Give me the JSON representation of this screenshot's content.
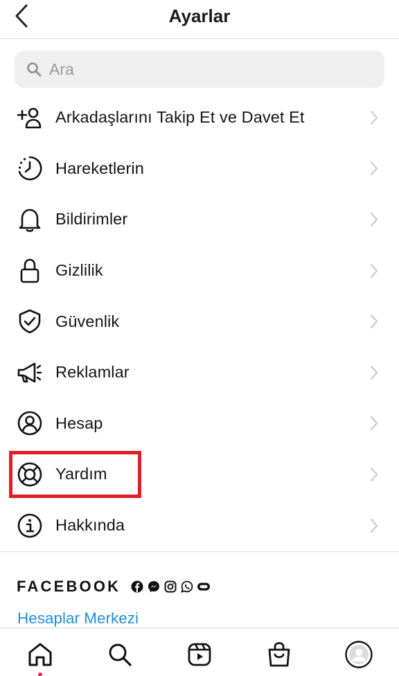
{
  "header": {
    "title": "Ayarlar",
    "back_icon": "chevron-left-icon"
  },
  "search": {
    "placeholder": "Ara",
    "value": "",
    "icon": "search-icon"
  },
  "menu": {
    "items": [
      {
        "label": "Arkadaşlarını Takip Et ve Davet Et",
        "icon": "add-person-icon"
      },
      {
        "label": "Hareketlerin",
        "icon": "activity-clock-icon"
      },
      {
        "label": "Bildirimler",
        "icon": "bell-icon"
      },
      {
        "label": "Gizlilik",
        "icon": "lock-icon"
      },
      {
        "label": "Güvenlik",
        "icon": "shield-check-icon"
      },
      {
        "label": "Reklamlar",
        "icon": "megaphone-icon"
      },
      {
        "label": "Hesap",
        "icon": "account-circle-icon"
      },
      {
        "label": "Yardım",
        "icon": "lifebuoy-icon"
      },
      {
        "label": "Hakkında",
        "icon": "info-icon"
      }
    ],
    "highlighted_item": "Yardım",
    "highlight_color": "#e01e25"
  },
  "facebook": {
    "title": "FACEBOOK",
    "icons": [
      "facebook-icon",
      "messenger-icon",
      "instagram-icon",
      "whatsapp-icon",
      "portal-icon"
    ],
    "accounts_link": "Hesaplar Merkezi",
    "link_color": "#1f8fd8"
  },
  "tabbar": {
    "tabs": [
      "home-icon",
      "search-icon",
      "reels-icon",
      "shop-icon",
      "profile-avatar"
    ],
    "active_tab": "home-icon",
    "notification_dot_color": "#ed1e4e"
  }
}
